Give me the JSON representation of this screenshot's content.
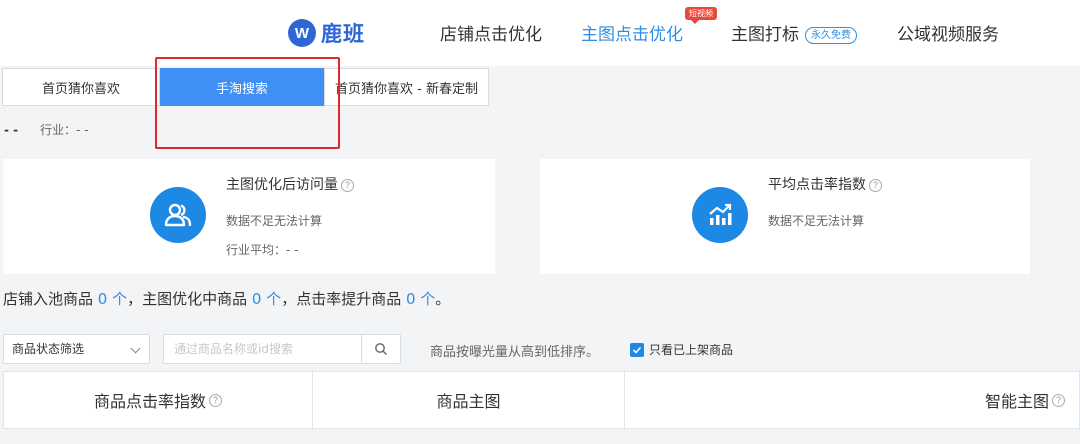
{
  "brand": {
    "logo_mark": "W",
    "name": "鹿班"
  },
  "nav": {
    "items": [
      {
        "label": "店铺点击优化"
      },
      {
        "label": "主图点击优化",
        "badge": "短视频"
      },
      {
        "label": "主图打标",
        "tag": "永久免费"
      },
      {
        "label": "公域视频服务"
      }
    ]
  },
  "tabs": [
    "首页猜你喜欢",
    "手淘搜索",
    "首页猜你喜欢 - 新春定制"
  ],
  "industry": {
    "dash": "- -",
    "label": "行业：- -"
  },
  "cards": {
    "visits": {
      "title": "主图优化后访问量",
      "status": "数据不足无法计算",
      "avg": "行业平均：- -"
    },
    "ctr": {
      "title": "平均点击率指数",
      "status": "数据不足无法计算"
    }
  },
  "summary": {
    "p1": "店铺入池商品 ",
    "n1": "0 个",
    "p2": "，主图优化中商品 ",
    "n2": "0 个",
    "p3": "，点击率提升商品 ",
    "n3": "0 个",
    "p4": "。"
  },
  "filters": {
    "status_select": "商品状态筛选",
    "search_placeholder": "通过商品名称或id搜索",
    "sort_note": "商品按曝光量从高到低排序。",
    "only_listed": "只看已上架商品"
  },
  "table": {
    "headers": [
      "商品点击率指数",
      "商品主图",
      "智能主图"
    ]
  },
  "colors": {
    "accent": "#1e88e5",
    "tab_active": "#3f8ff4",
    "highlight": "#d92b2b",
    "nav_active": "#2f8ee0"
  },
  "icons": [
    "users-icon",
    "trend-chart-icon",
    "search-icon",
    "help-icon",
    "chevron-down-icon",
    "checkmark-icon"
  ]
}
